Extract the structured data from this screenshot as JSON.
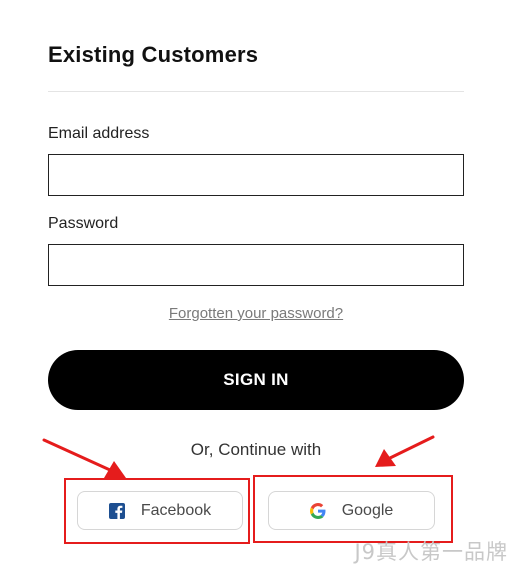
{
  "heading": "Existing Customers",
  "form": {
    "email_label": "Email address",
    "email_value": "",
    "password_label": "Password",
    "password_value": "",
    "forgot_link": "Forgotten your password?",
    "signin_label": "SIGN IN"
  },
  "social": {
    "divider_text": "Or, Continue with",
    "facebook_label": "Facebook",
    "google_label": "Google",
    "facebook_icon": "facebook-icon",
    "google_icon": "google-icon"
  },
  "annotations": {
    "color": "#e51c1c"
  },
  "watermark": "J9真人第一品牌"
}
